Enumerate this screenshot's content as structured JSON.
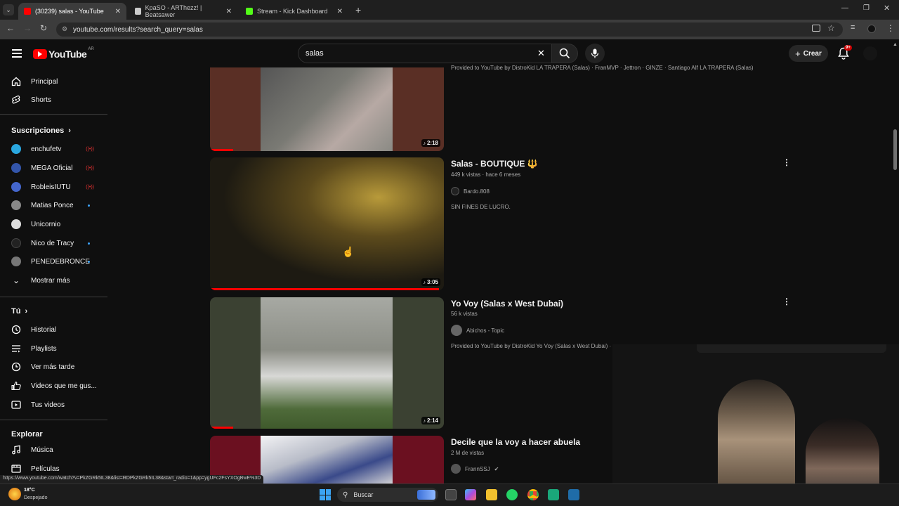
{
  "browser": {
    "tabs": [
      {
        "title": "(30239) salas - YouTube",
        "active": true,
        "color": "#ff0000"
      },
      {
        "title": "KpaSO - ARThezz! | Beatsawer",
        "active": false,
        "color": "#cccccc"
      },
      {
        "title": "Stream - Kick Dashboard",
        "active": false,
        "color": "#53fc18"
      }
    ],
    "url": "youtube.com/results?search_query=salas",
    "status_url": "https://www.youtube.com/watch?v=PkZGRk5IL38&list=RDPkZGRk5IL38&start_radio=1&pp=ygUFc2FsYXOgBwE%3D"
  },
  "header": {
    "logo": "YouTube",
    "region": "AR",
    "search_value": "salas",
    "create_label": "Crear",
    "notif_badge": "9+"
  },
  "sidebar": {
    "main": [
      {
        "label": "Principal",
        "icon": "home-icon"
      },
      {
        "label": "Shorts",
        "icon": "shorts-icon"
      }
    ],
    "subs_heading": "Suscripciones",
    "subscriptions": [
      {
        "label": "enchufetv",
        "status": "live",
        "color": "#2aa7df"
      },
      {
        "label": "MEGA Oficial",
        "status": "live",
        "color": "#3355aa"
      },
      {
        "label": "RobleisIUTU",
        "status": "live",
        "color": "#4466cc"
      },
      {
        "label": "Matias Ponce",
        "status": "new",
        "color": "#888888"
      },
      {
        "label": "Unicornio",
        "status": "",
        "color": "#dddddd"
      },
      {
        "label": "Nico de Tracy",
        "status": "new",
        "color": "#222222"
      },
      {
        "label": "PENEDEBRONCE",
        "status": "new",
        "color": "#777777"
      }
    ],
    "show_more": "Mostrar más",
    "you_heading": "Tú",
    "you_items": [
      {
        "label": "Historial",
        "icon": "history-icon"
      },
      {
        "label": "Playlists",
        "icon": "playlists-icon"
      },
      {
        "label": "Ver más tarde",
        "icon": "watch-later-icon"
      },
      {
        "label": "Videos que me gus...",
        "icon": "like-icon"
      },
      {
        "label": "Tus videos",
        "icon": "your-videos-icon"
      }
    ],
    "explore_heading": "Explorar",
    "explore_items": [
      {
        "label": "Música",
        "icon": "music-icon"
      },
      {
        "label": "Películas",
        "icon": "movies-icon"
      }
    ]
  },
  "results": [
    {
      "title": "",
      "meta": "",
      "channel": "",
      "description": "Provided to YouTube by DistroKid LA TRAPERA (Salas) · FranMVP · Jettron · GINZE · Santiago AIf LA TRAPERA (Salas) ...",
      "duration": "2:18",
      "progress": 0.1,
      "bg": "#5a2f25",
      "img": "#6b6b66"
    },
    {
      "title": "Salas - BOUTIQUE 🔱",
      "meta": "449 k vistas · hace 6 meses",
      "channel": "Bardo.808",
      "description": "SIN FINES DE LUCRO.",
      "duration": "3:05",
      "progress": 0.98,
      "bg": "#1a1a14",
      "img": "#2a2618"
    },
    {
      "title": "Yo Voy (Salas x West Dubai)",
      "meta": "56 k vistas",
      "channel": "Abichos - Topic",
      "description": "Provided to YouTube by DistroKid Yo Voy (Salas x West Dubai) · Al",
      "duration": "2:14",
      "progress": 0.1,
      "bg": "#3b4132",
      "img": "#8a8f82"
    },
    {
      "title": "Decile que la voy a hacer abuela",
      "meta": "2 M de vistas",
      "channel": "FrannSSJ",
      "description": "",
      "duration": "",
      "progress": 0,
      "bg": "#6b1020",
      "img": "#c8c8d0"
    }
  ],
  "taskbar": {
    "weather_temp": "18°C",
    "weather_desc": "Despejado",
    "search_placeholder": "Buscar"
  }
}
